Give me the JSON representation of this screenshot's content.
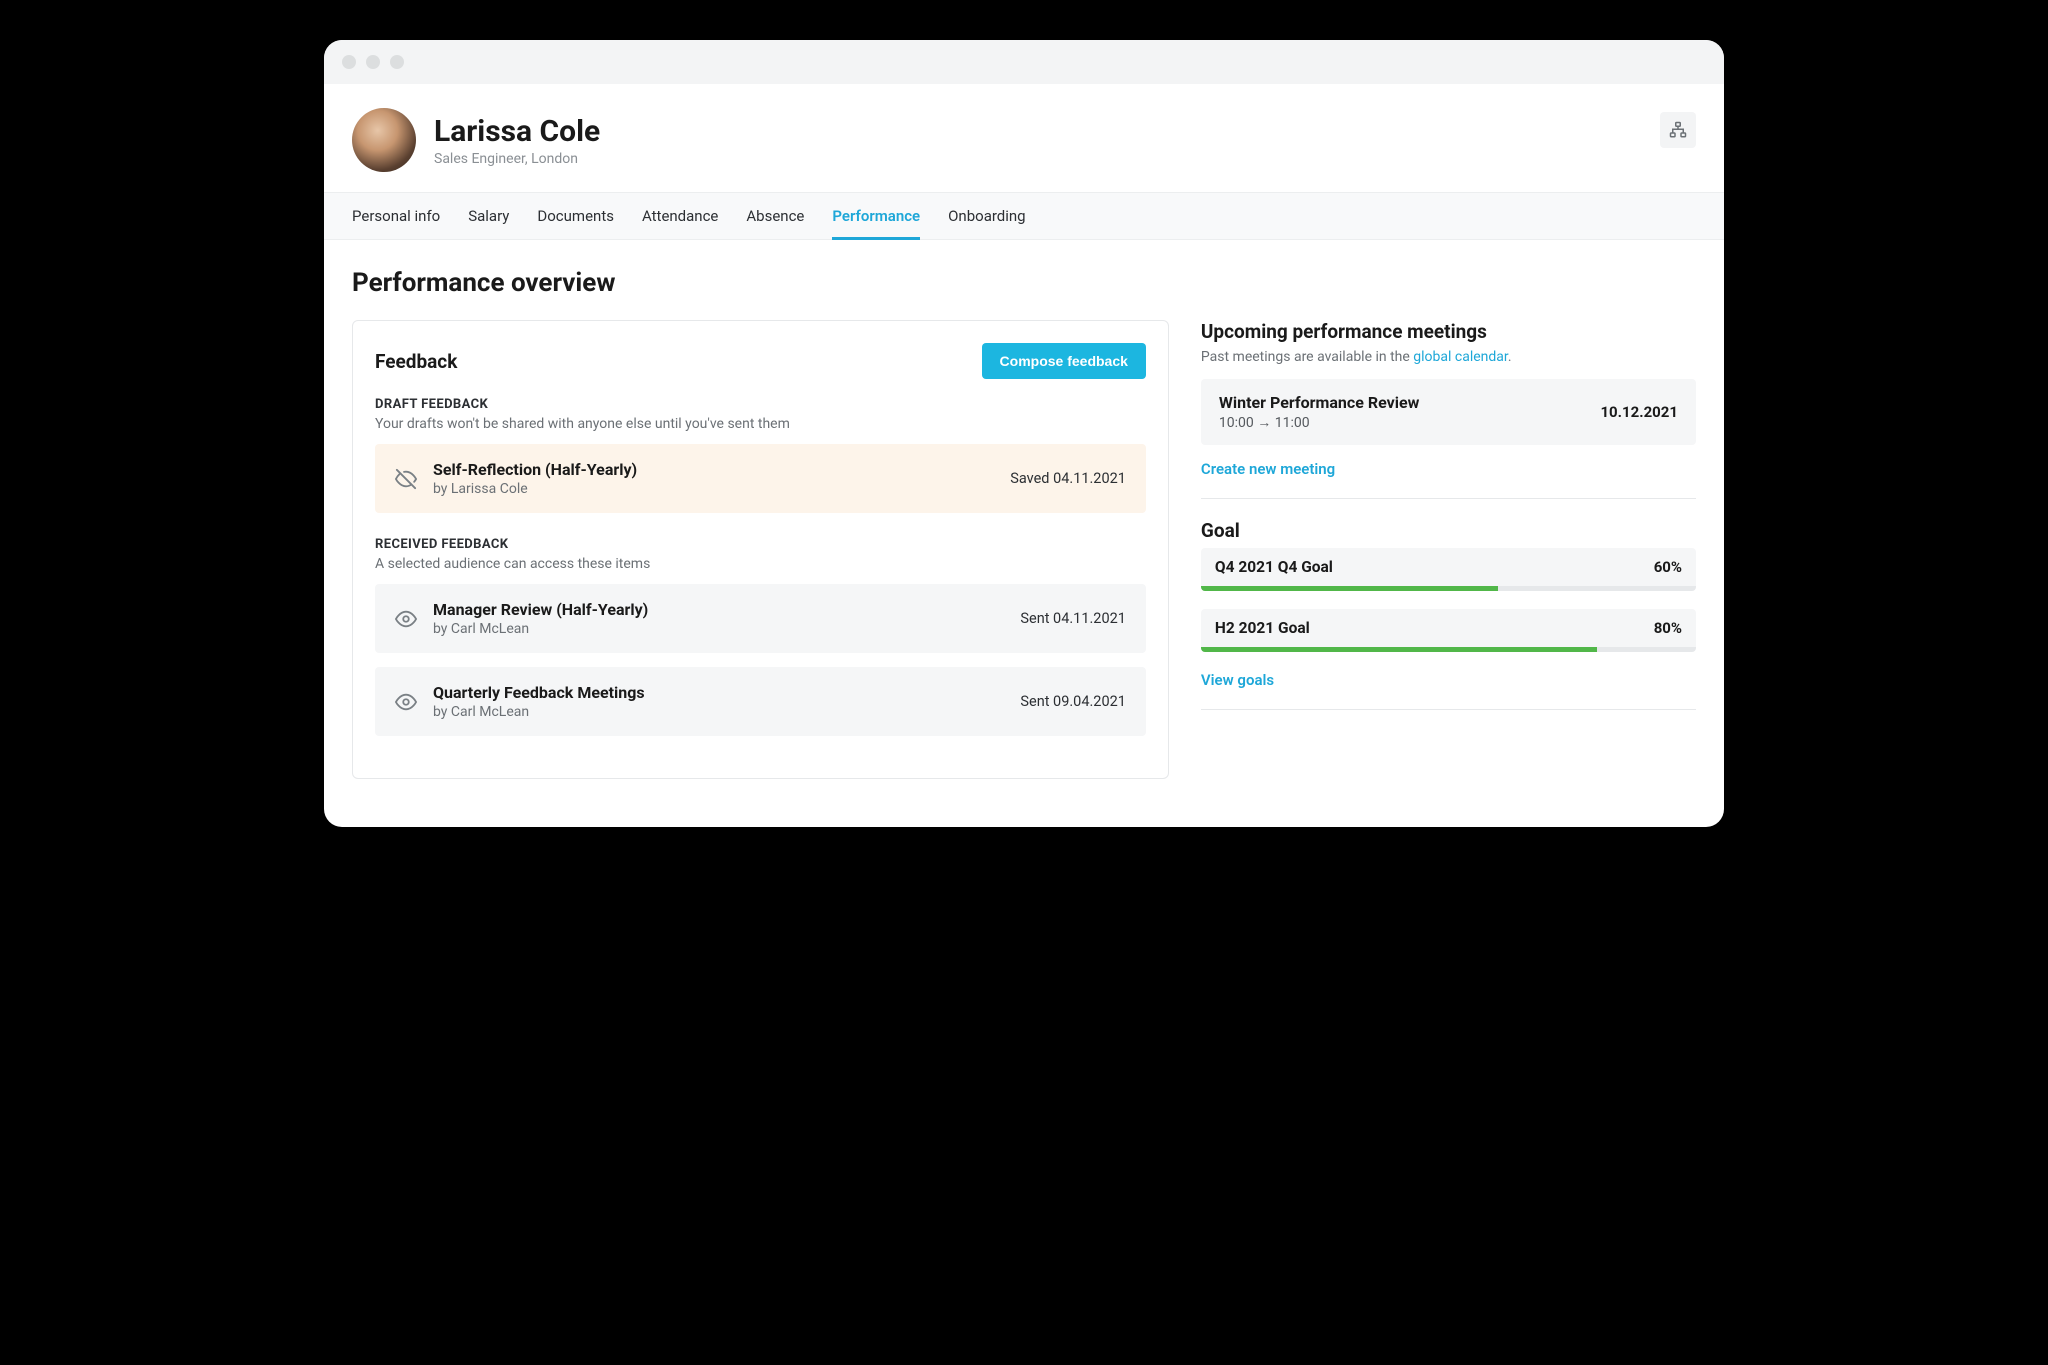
{
  "user": {
    "name": "Larissa Cole",
    "subtitle": "Sales Engineer, London"
  },
  "tabs": [
    {
      "label": "Personal info",
      "active": false
    },
    {
      "label": "Salary",
      "active": false
    },
    {
      "label": "Documents",
      "active": false
    },
    {
      "label": "Attendance",
      "active": false
    },
    {
      "label": "Absence",
      "active": false
    },
    {
      "label": "Performance",
      "active": true
    },
    {
      "label": "Onboarding",
      "active": false
    }
  ],
  "page_title": "Performance overview",
  "feedback": {
    "title": "Feedback",
    "compose_label": "Compose feedback",
    "draft": {
      "heading": "DRAFT FEEDBACK",
      "hint": "Your drafts won't be shared with anyone else until you've sent them",
      "items": [
        {
          "title": "Self-Reflection (Half-Yearly)",
          "by": "by Larissa Cole",
          "status": "Saved 04.11.2021"
        }
      ]
    },
    "received": {
      "heading": "RECEIVED FEEDBACK",
      "hint": "A selected audience can access these items",
      "items": [
        {
          "title": "Manager Review (Half-Yearly)",
          "by": "by Carl McLean",
          "status": "Sent 04.11.2021"
        },
        {
          "title": "Quarterly Feedback Meetings",
          "by": "by Carl McLean",
          "status": "Sent 09.04.2021"
        }
      ]
    }
  },
  "meetings": {
    "heading": "Upcoming performance meetings",
    "hint_prefix": "Past meetings are available in the ",
    "hint_link": "global calendar",
    "hint_suffix": ".",
    "items": [
      {
        "title": "Winter Performance Review",
        "time": "10:00 → 11:00",
        "date": "10.12.2021"
      }
    ],
    "create_label": "Create new meeting"
  },
  "goals": {
    "heading": "Goal",
    "items": [
      {
        "name": "Q4 2021 Q4 Goal",
        "pct_label": "60%",
        "pct": 60
      },
      {
        "name": "H2 2021 Goal",
        "pct_label": "80%",
        "pct": 80
      }
    ],
    "view_label": "View goals"
  }
}
